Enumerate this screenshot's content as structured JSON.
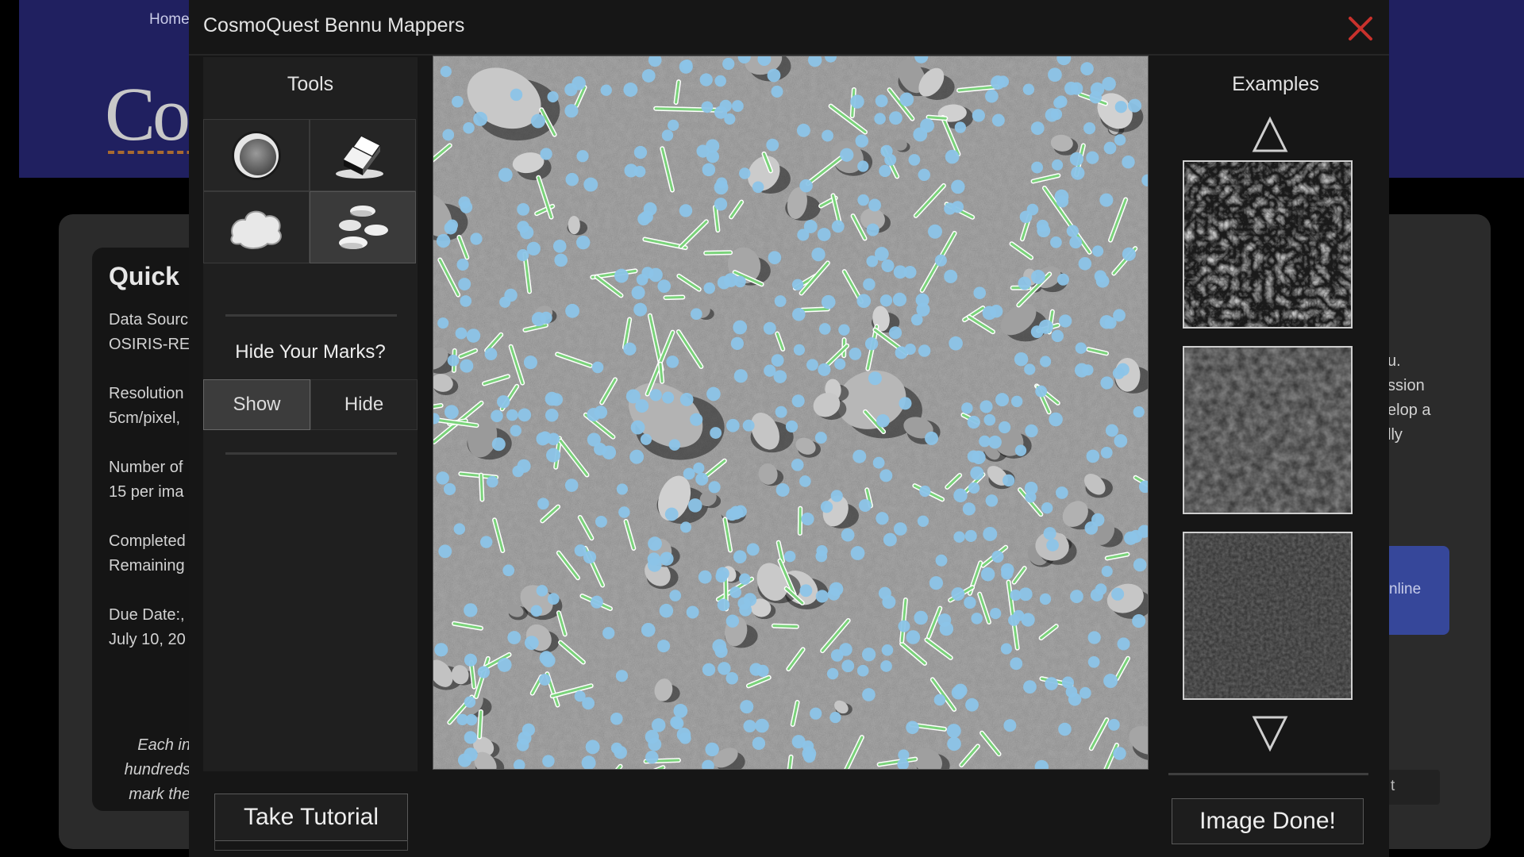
{
  "background_page": {
    "nav_home": "Home",
    "logo_text": "Co",
    "card_title": "Quick",
    "card_lines": "Data Sourc\nOSIRIS-RE\n\nResolution\n5cm/pixel,\n\nNumber of\n15 per ima\n\nCompleted\nRemaining\n\nDue Date:,\nJuly 10, 20",
    "card_italic": "Each in\nhundreds\nmark the",
    "right_text": "u.\nssion\nelop a\nlly",
    "right_button": "nline",
    "right_box": "t"
  },
  "modal": {
    "title": "CosmoQuest Bennu Mappers",
    "close_icon": "close-x-icon",
    "accent_color": "#c8312c"
  },
  "tools": {
    "title": "Tools",
    "items": [
      {
        "icon": "crater-tool-icon",
        "selected": false
      },
      {
        "icon": "eraser-tool-icon",
        "selected": false
      },
      {
        "icon": "boulder-tool-icon",
        "selected": false
      },
      {
        "icon": "rocks-tool-icon",
        "selected": true
      }
    ],
    "hide_label": "Hide Your Marks?",
    "show_label": "Show",
    "hide_button_label": "Hide",
    "active_toggle": "Show",
    "tutorial_label": "Take Tutorial"
  },
  "image": {
    "mark_colors": {
      "dot": "#8cc4e8",
      "line": "#7bd37b"
    }
  },
  "examples": {
    "title": "Examples",
    "up_icon": "triangle-up-icon",
    "down_icon": "triangle-down-icon",
    "thumbnails": [
      "dense-rocky-terrain",
      "smooth-dark-terrain",
      "fine-grained-terrain"
    ],
    "done_label": "Image Done!"
  }
}
